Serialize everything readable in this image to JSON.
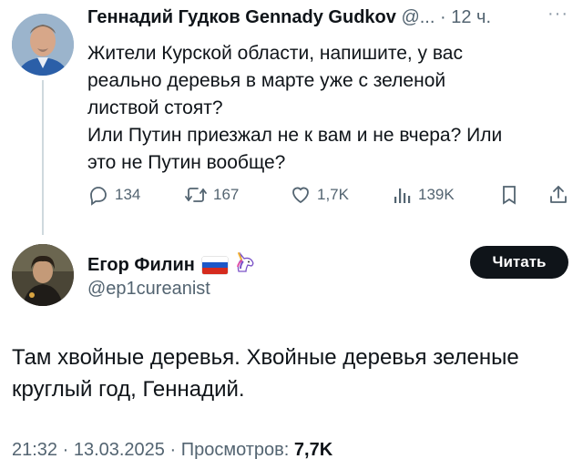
{
  "parent": {
    "author_name": "Геннадий Гудков Gennady Gudkov",
    "handle_truncated": "@...",
    "separator": "·",
    "time": "12 ч.",
    "text_lines": [
      "Жители Курской области, напишите, у вас",
      "реально деревья в марте уже с зеленой",
      "листвой стоят?",
      "Или Путин приезжал не к вам и не вчера? Или",
      "это не Путин вообще?"
    ],
    "actions": {
      "replies": "134",
      "reposts": "167",
      "likes": "1,7K",
      "views": "139K"
    }
  },
  "reply": {
    "author_name": "Егор Филин",
    "handle": "@ep1cureanist",
    "follow_label": "Читать",
    "text_lines": [
      "Там хвойные деревья. Хвойные деревья зеленые",
      "круглый год, Геннадий."
    ],
    "timestamp": "21:32 · 13.03.2025 · Просмотров: ",
    "views_count": "7,7K"
  },
  "colors": {
    "text": "#0f1419",
    "muted": "#536471",
    "thread_line": "#cfd9de",
    "button_bg": "#0f1419"
  },
  "icons": [
    "reply-icon",
    "repost-icon",
    "like-icon",
    "views-icon",
    "bookmark-icon",
    "share-icon",
    "more-icon",
    "flag-ru-icon",
    "unicorn-icon"
  ]
}
